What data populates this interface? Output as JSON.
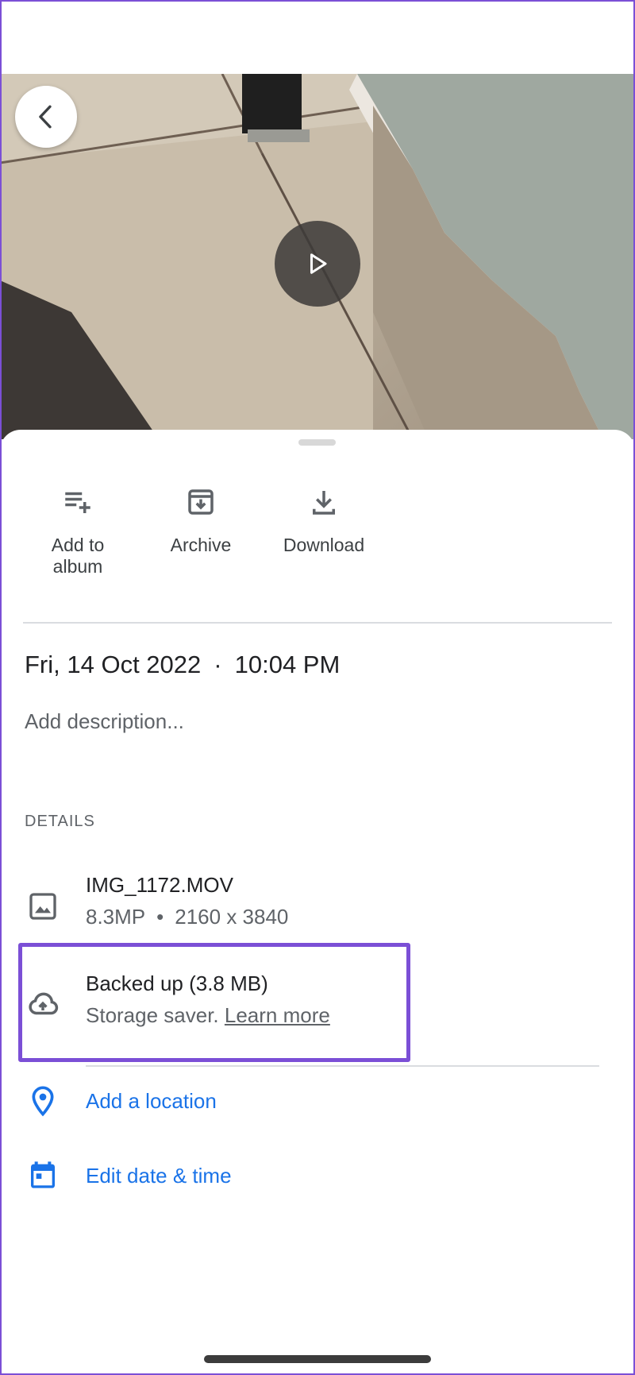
{
  "media": {
    "back_icon": "chevron-left-icon",
    "play_icon": "play-icon"
  },
  "actions": [
    {
      "label": "Add to\nalbum",
      "icon": "playlist-add-icon"
    },
    {
      "label": "Archive",
      "icon": "archive-icon"
    },
    {
      "label": "Download",
      "icon": "download-icon"
    }
  ],
  "info": {
    "date": "Fri, 14 Oct 2022",
    "separator": "·",
    "time": "10:04 PM",
    "description_placeholder": "Add description..."
  },
  "details": {
    "section_label": "DETAILS",
    "file": {
      "name": "IMG_1172.MOV",
      "megapixels": "8.3MP",
      "separator": "•",
      "resolution": "2160 x 3840",
      "icon": "image-icon"
    },
    "backup": {
      "title": "Backed up (3.8 MB)",
      "subtitle": "Storage saver.",
      "link": "Learn more",
      "icon": "cloud-upload-icon"
    },
    "location": {
      "label": "Add a location",
      "icon": "location-pin-icon"
    },
    "edit_date": {
      "label": "Edit date & time",
      "icon": "calendar-icon"
    }
  },
  "colors": {
    "accent_blue": "#1a73e8",
    "highlight_purple": "#7b4fd6"
  }
}
